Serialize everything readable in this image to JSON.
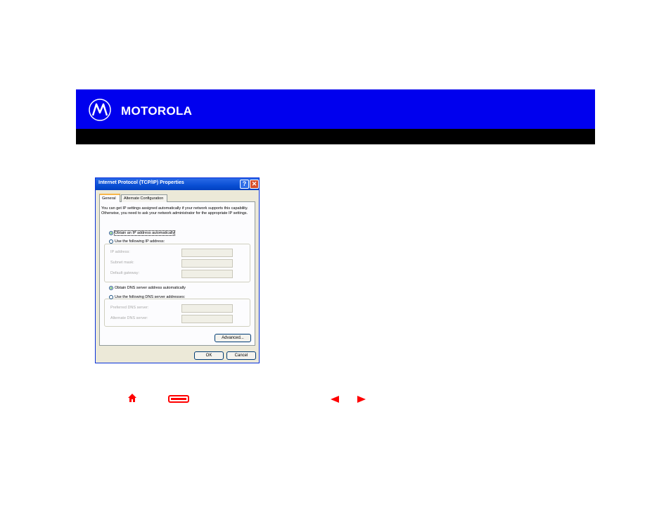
{
  "brand": {
    "name": "MOTOROLA"
  },
  "dialog": {
    "title": "Internet Protocol (TCP/IP) Properties",
    "help_button": "?",
    "close_button": "✕",
    "tabs": [
      {
        "label": "General",
        "active": true
      },
      {
        "label": "Alternate Configuration",
        "active": false
      }
    ],
    "description": "You can get IP settings assigned automatically if your network supports this capability. Otherwise, you need to ask your network administrator for the appropriate IP settings.",
    "ip_options": [
      {
        "label": "Obtain an IP address automatically",
        "checked": true
      },
      {
        "label": "Use the following IP address:",
        "checked": false
      }
    ],
    "ip_fields": [
      {
        "label": "IP address:",
        "value": ". . ."
      },
      {
        "label": "Subnet mask:",
        "value": ". . ."
      },
      {
        "label": "Default gateway:",
        "value": ". . ."
      }
    ],
    "dns_options": [
      {
        "label": "Obtain DNS server address automatically",
        "checked": true
      },
      {
        "label": "Use the following DNS server addresses:",
        "checked": false
      }
    ],
    "dns_fields": [
      {
        "label": "Preferred DNS server:",
        "value": ". . ."
      },
      {
        "label": "Alternate DNS server:",
        "value": ". . ."
      }
    ],
    "advanced_label": "Advanced...",
    "ok_label": "OK",
    "cancel_label": "Cancel"
  },
  "navigation": {
    "icons": [
      "home-icon",
      "print-icon",
      "previous-arrow-icon",
      "next-arrow-icon"
    ],
    "accent_color": "#ff0000"
  },
  "colors": {
    "banner": "#0000ee",
    "banner_bar": "#000000"
  }
}
